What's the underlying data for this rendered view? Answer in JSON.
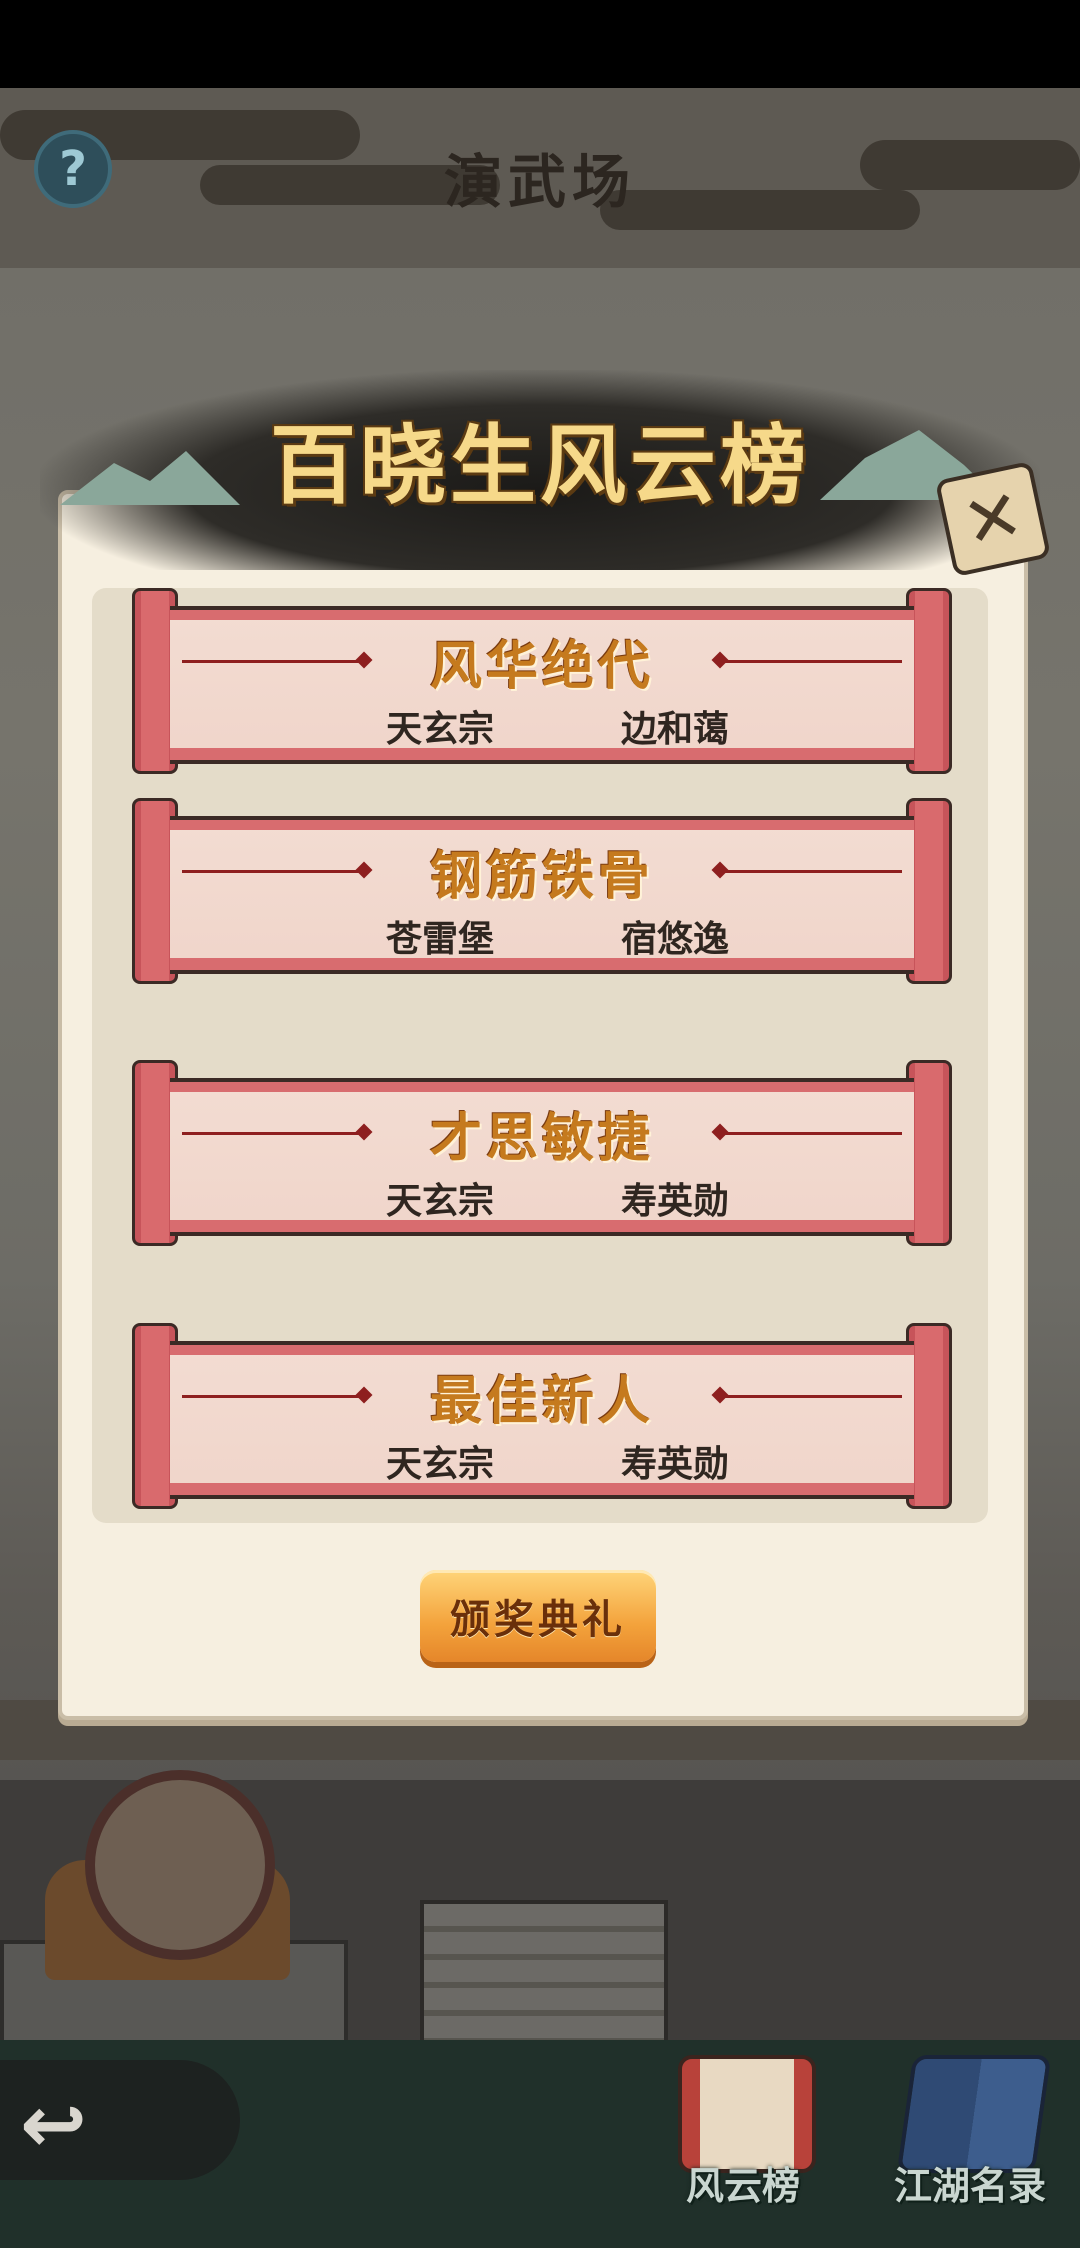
{
  "header": {
    "title": "演武场",
    "help_symbol": "?"
  },
  "modal": {
    "title": "百晓生风云榜",
    "close_symbol": "✕",
    "awards": [
      {
        "title": "风华绝代",
        "sect": "天玄宗",
        "winner": "边和蔼"
      },
      {
        "title": "钢筋铁骨",
        "sect": "苍雷堡",
        "winner": "宿悠逸"
      },
      {
        "title": "才思敏捷",
        "sect": "天玄宗",
        "winner": "寿英勋"
      },
      {
        "title": "最佳新人",
        "sect": "天玄宗",
        "winner": "寿英勋"
      }
    ],
    "ceremony_button": "颁奖典礼"
  },
  "bottom_nav": {
    "back_symbol": "↩",
    "ranking_label": "风云榜",
    "roster_label": "江湖名录"
  },
  "colors": {
    "panel_bg": "#f6efe0",
    "scroll_red": "#d96a6d",
    "title_gold": "#f6d98a",
    "button_orange": "#f3a23b"
  }
}
